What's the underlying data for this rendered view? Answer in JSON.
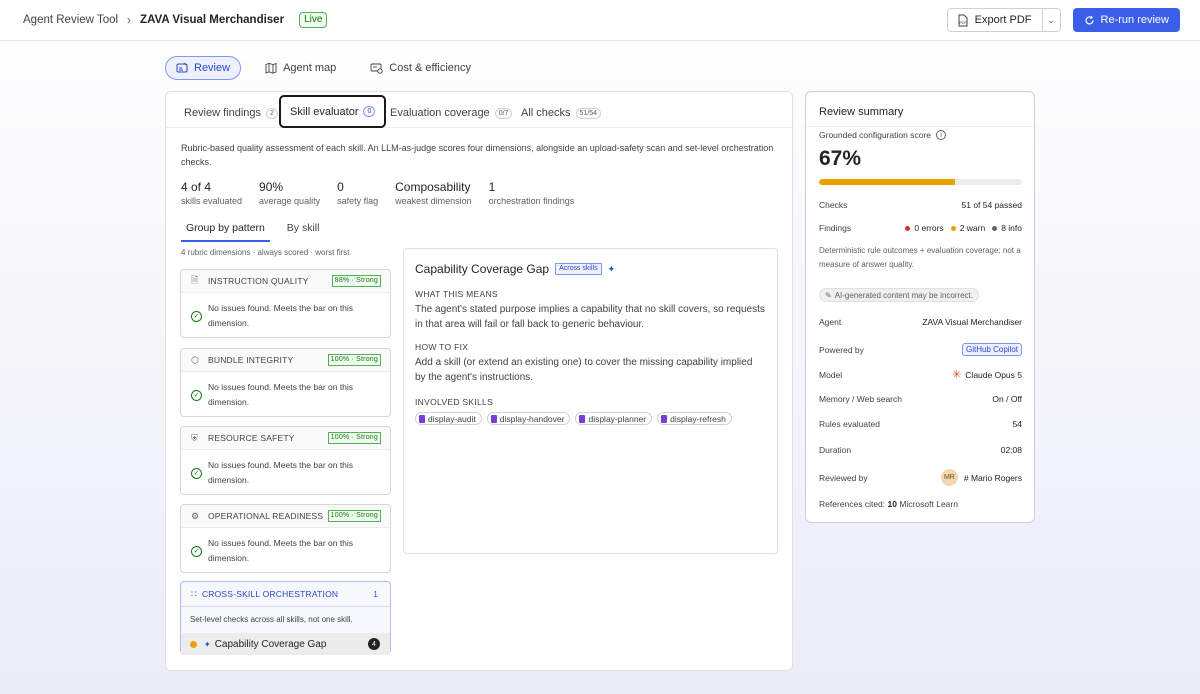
{
  "breadcrumb": {
    "root": "Agent Review Tool",
    "current": "ZAVA Visual Merchandiser",
    "status": "Live"
  },
  "actions": {
    "export_label": "Export PDF",
    "rerun_label": "Re-run review"
  },
  "topnav": [
    {
      "label": "Review",
      "icon": "review-icon",
      "active": true
    },
    {
      "label": "Agent map",
      "icon": "map-icon"
    },
    {
      "label": "Cost & efficiency",
      "icon": "cost-icon"
    }
  ],
  "tabs": [
    {
      "label": "Review findings",
      "count": "2"
    },
    {
      "label": "Skill evaluator",
      "count": "0",
      "selected": true
    },
    {
      "label": "Evaluation coverage",
      "count": "0/7"
    },
    {
      "label": "All checks",
      "count": "51/54"
    }
  ],
  "description": "Rubric-based quality assessment of each skill. An LLM-as-judge scores four dimensions, alongside an upload-safety scan and set-level orchestration checks.",
  "stats": [
    {
      "value": "4 of 4",
      "label": "skills evaluated"
    },
    {
      "value": "90%",
      "label": "average quality"
    },
    {
      "value": "0",
      "label": "safety flag"
    },
    {
      "value": "Composability",
      "label": "weakest dimension"
    },
    {
      "value": "1",
      "label": "orchestration findings"
    }
  ],
  "subtabs": [
    {
      "label": "Group by pattern"
    },
    {
      "label": "By skill"
    }
  ],
  "dimensions_note": "4 rubric dimensions · always scored · worst first",
  "dimensions": [
    {
      "title": "INSTRUCTION QUALITY",
      "score": "88% · Strong",
      "text": "No issues found. Meets the bar on this dimension."
    },
    {
      "title": "BUNDLE INTEGRITY",
      "score": "100% · Strong",
      "text": "No issues found. Meets the bar on this dimension."
    },
    {
      "title": "RESOURCE SAFETY",
      "score": "100% · Strong",
      "text": "No issues found. Meets the bar on this dimension."
    },
    {
      "title": "OPERATIONAL READINESS",
      "score": "100% · Strong",
      "text": "No issues found. Meets the bar on this dimension."
    }
  ],
  "cross": {
    "title": "CROSS-SKILL ORCHESTRATION",
    "count": "1",
    "desc": "Set-level checks across all skills, not one skill.",
    "item": "Capability Coverage Gap",
    "item_count": "4"
  },
  "detail": {
    "title": "Capability Coverage Gap",
    "scope": "Across skills",
    "what_label": "WHAT THIS MEANS",
    "what_text": "The agent's stated purpose implies a capability that no skill covers, so requests in that area will fail or fall back to generic behaviour.",
    "fix_label": "HOW TO FIX",
    "fix_text": "Add a skill (or extend an existing one) to cover the missing capability implied by the agent's instructions.",
    "skills_label": "INVOLVED SKILLS",
    "skills": [
      "display-audit",
      "display-handover",
      "display-planner",
      "display-refresh"
    ]
  },
  "summary": {
    "title": "Review summary",
    "score_label": "Grounded configuration score",
    "score": "67%",
    "score_fraction": 0.67,
    "checks_label": "Checks",
    "checks_value": "51 of 54 passed",
    "findings_label": "Findings",
    "errors": "0 errors",
    "warn": "2 warn",
    "info": "8 info",
    "note": "Deterministic rule outcomes + evaluation coverage; not a measure of answer quality.",
    "ai_note": "AI-generated content may be incorrect.",
    "rows": [
      {
        "label": "Agent",
        "value": "ZAVA Visual Merchandiser"
      },
      {
        "label": "Powered by",
        "value": "GitHub Copilot"
      },
      {
        "label": "Model",
        "value": "Claude Opus 5"
      },
      {
        "label": "Memory / Web search",
        "value": "On / Off"
      },
      {
        "label": "Rules evaluated",
        "value": "54"
      },
      {
        "label": "Duration",
        "value": "02:08"
      },
      {
        "label": "Reviewed by",
        "value": "# Mario Rogers",
        "initials": "MR"
      }
    ],
    "refs_prefix": "References cited:",
    "refs_count": "10",
    "refs_suffix": "Microsoft Learn"
  },
  "colors": {
    "accent": "#3b5ee8",
    "success": "#107c10",
    "warning": "#e8a300",
    "error": "#d13438",
    "info": "#616161"
  }
}
